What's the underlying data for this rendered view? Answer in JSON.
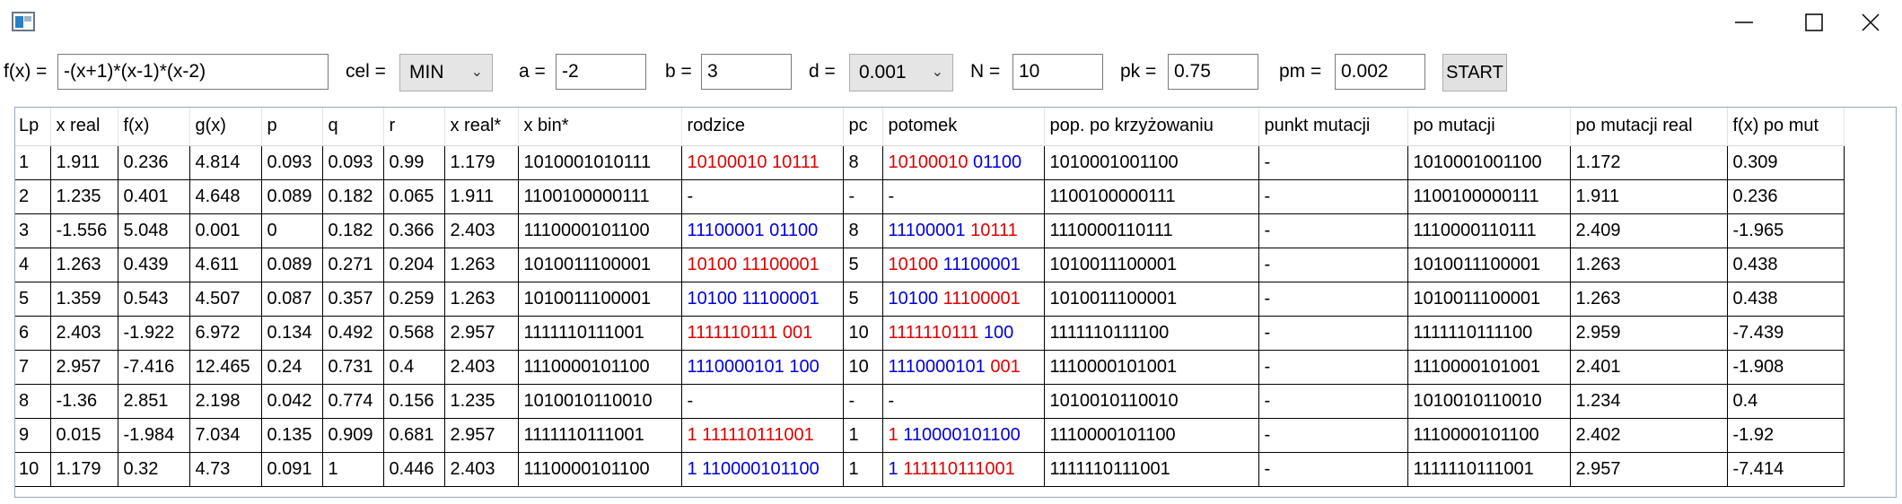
{
  "window": {
    "icon": "app-window-icon",
    "controls": {
      "minimize_icon": "minimize-icon",
      "maximize_icon": "maximize-icon",
      "close_icon": "close-icon"
    }
  },
  "params": {
    "fx_label": "f(x) =",
    "fx_value": "-(x+1)*(x-1)*(x-2)",
    "cel_label": "cel =",
    "cel_value": "MIN",
    "a_label": "a =",
    "a_value": "-2",
    "b_label": "b =",
    "b_value": "3",
    "d_label": "d =",
    "d_value": "0.001",
    "n_label": "N =",
    "n_value": "10",
    "pk_label": "pk =",
    "pk_value": "0.75",
    "pm_label": "pm =",
    "pm_value": "0.002",
    "start_label": "START"
  },
  "table": {
    "headers": [
      "Lp",
      "x real",
      "f(x)",
      "g(x)",
      "p",
      "q",
      "r",
      "x real*",
      "x bin*",
      "rodzice",
      "pc",
      "potomek",
      "pop. po krzyżowaniu",
      "punkt mutacji",
      "po mutacji",
      "po mutacji real",
      "f(x) po mut"
    ],
    "rows": [
      {
        "lp": "1",
        "xreal": "1.911",
        "fx": "0.236",
        "gx": "4.814",
        "p": "0.093",
        "q": "0.093",
        "r": "0.99",
        "xreal_s": "1.179",
        "xbin_s": "1010001010111",
        "rodzice": [
          {
            "t": "10100010 10111",
            "c": "red"
          }
        ],
        "pc": "8",
        "potomek": [
          {
            "t": "10100010 ",
            "c": "red"
          },
          {
            "t": "01100",
            "c": "blue"
          }
        ],
        "pop": "1010001001100",
        "pm": "-",
        "pomut": "1010001001100",
        "pomutreal": "1.172",
        "fxpomut": "0.309"
      },
      {
        "lp": "2",
        "xreal": "1.235",
        "fx": "0.401",
        "gx": "4.648",
        "p": "0.089",
        "q": "0.182",
        "r": "0.065",
        "xreal_s": "1.911",
        "xbin_s": "1100100000111",
        "rodzice": [
          {
            "t": "-",
            "c": "black"
          }
        ],
        "pc": "-",
        "potomek": [
          {
            "t": "-",
            "c": "black"
          }
        ],
        "pop": "1100100000111",
        "pm": "-",
        "pomut": "1100100000111",
        "pomutreal": "1.911",
        "fxpomut": "0.236"
      },
      {
        "lp": "3",
        "xreal": "-1.556",
        "fx": "5.048",
        "gx": "0.001",
        "p": "0",
        "q": "0.182",
        "r": "0.366",
        "xreal_s": "2.403",
        "xbin_s": "1110000101100",
        "rodzice": [
          {
            "t": "11100001 01100",
            "c": "blue"
          }
        ],
        "pc": "8",
        "potomek": [
          {
            "t": "11100001 ",
            "c": "blue"
          },
          {
            "t": "10111",
            "c": "red"
          }
        ],
        "pop": "1110000110111",
        "pm": "-",
        "pomut": "1110000110111",
        "pomutreal": "2.409",
        "fxpomut": "-1.965"
      },
      {
        "lp": "4",
        "xreal": "1.263",
        "fx": "0.439",
        "gx": "4.611",
        "p": "0.089",
        "q": "0.271",
        "r": "0.204",
        "xreal_s": "1.263",
        "xbin_s": "1010011100001",
        "rodzice": [
          {
            "t": "10100 11100001",
            "c": "red"
          }
        ],
        "pc": "5",
        "potomek": [
          {
            "t": "10100 ",
            "c": "red"
          },
          {
            "t": "11100001",
            "c": "blue"
          }
        ],
        "pop": "1010011100001",
        "pm": "-",
        "pomut": "1010011100001",
        "pomutreal": "1.263",
        "fxpomut": "0.438"
      },
      {
        "lp": "5",
        "xreal": "1.359",
        "fx": "0.543",
        "gx": "4.507",
        "p": "0.087",
        "q": "0.357",
        "r": "0.259",
        "xreal_s": "1.263",
        "xbin_s": "1010011100001",
        "rodzice": [
          {
            "t": "10100 11100001",
            "c": "blue"
          }
        ],
        "pc": "5",
        "potomek": [
          {
            "t": "10100 ",
            "c": "blue"
          },
          {
            "t": "11100001",
            "c": "red"
          }
        ],
        "pop": "1010011100001",
        "pm": "-",
        "pomut": "1010011100001",
        "pomutreal": "1.263",
        "fxpomut": "0.438"
      },
      {
        "lp": "6",
        "xreal": "2.403",
        "fx": "-1.922",
        "gx": "6.972",
        "p": "0.134",
        "q": "0.492",
        "r": "0.568",
        "xreal_s": "2.957",
        "xbin_s": "1111110111001",
        "rodzice": [
          {
            "t": "1111110111 001",
            "c": "red"
          }
        ],
        "pc": "10",
        "potomek": [
          {
            "t": "1111110111 ",
            "c": "red"
          },
          {
            "t": "100",
            "c": "blue"
          }
        ],
        "pop": "1111110111100",
        "pm": "-",
        "pomut": "1111110111100",
        "pomutreal": "2.959",
        "fxpomut": "-7.439"
      },
      {
        "lp": "7",
        "xreal": "2.957",
        "fx": "-7.416",
        "gx": "12.465",
        "p": "0.24",
        "q": "0.731",
        "r": "0.4",
        "xreal_s": "2.403",
        "xbin_s": "1110000101100",
        "rodzice": [
          {
            "t": "1110000101 100",
            "c": "blue"
          }
        ],
        "pc": "10",
        "potomek": [
          {
            "t": "1110000101 ",
            "c": "blue"
          },
          {
            "t": "001",
            "c": "red"
          }
        ],
        "pop": "1110000101001",
        "pm": "-",
        "pomut": "1110000101001",
        "pomutreal": "2.401",
        "fxpomut": "-1.908"
      },
      {
        "lp": "8",
        "xreal": "-1.36",
        "fx": "2.851",
        "gx": "2.198",
        "p": "0.042",
        "q": "0.774",
        "r": "0.156",
        "xreal_s": "1.235",
        "xbin_s": "1010010110010",
        "rodzice": [
          {
            "t": "-",
            "c": "black"
          }
        ],
        "pc": "-",
        "potomek": [
          {
            "t": "-",
            "c": "black"
          }
        ],
        "pop": "1010010110010",
        "pm": "-",
        "pomut": "1010010110010",
        "pomutreal": "1.234",
        "fxpomut": "0.4"
      },
      {
        "lp": "9",
        "xreal": "0.015",
        "fx": "-1.984",
        "gx": "7.034",
        "p": "0.135",
        "q": "0.909",
        "r": "0.681",
        "xreal_s": "2.957",
        "xbin_s": "1111110111001",
        "rodzice": [
          {
            "t": "1 111110111001",
            "c": "red"
          }
        ],
        "pc": "1",
        "potomek": [
          {
            "t": "1 ",
            "c": "red"
          },
          {
            "t": "110000101100",
            "c": "blue"
          }
        ],
        "pop": "1110000101100",
        "pm": "-",
        "pomut": "1110000101100",
        "pomutreal": "2.402",
        "fxpomut": "-1.92"
      },
      {
        "lp": "10",
        "xreal": "1.179",
        "fx": "0.32",
        "gx": "4.73",
        "p": "0.091",
        "q": "1",
        "r": "0.446",
        "xreal_s": "2.403",
        "xbin_s": "1110000101100",
        "rodzice": [
          {
            "t": "1 110000101100",
            "c": "blue"
          }
        ],
        "pc": "1",
        "potomek": [
          {
            "t": "1 ",
            "c": "blue"
          },
          {
            "t": "111110111001",
            "c": "red"
          }
        ],
        "pop": "1111110111001",
        "pm": "-",
        "pomut": "1111110111001",
        "pomutreal": "2.957",
        "fxpomut": "-7.414"
      }
    ]
  },
  "colors": {
    "red": "#e00000",
    "blue": "#0000e0"
  }
}
